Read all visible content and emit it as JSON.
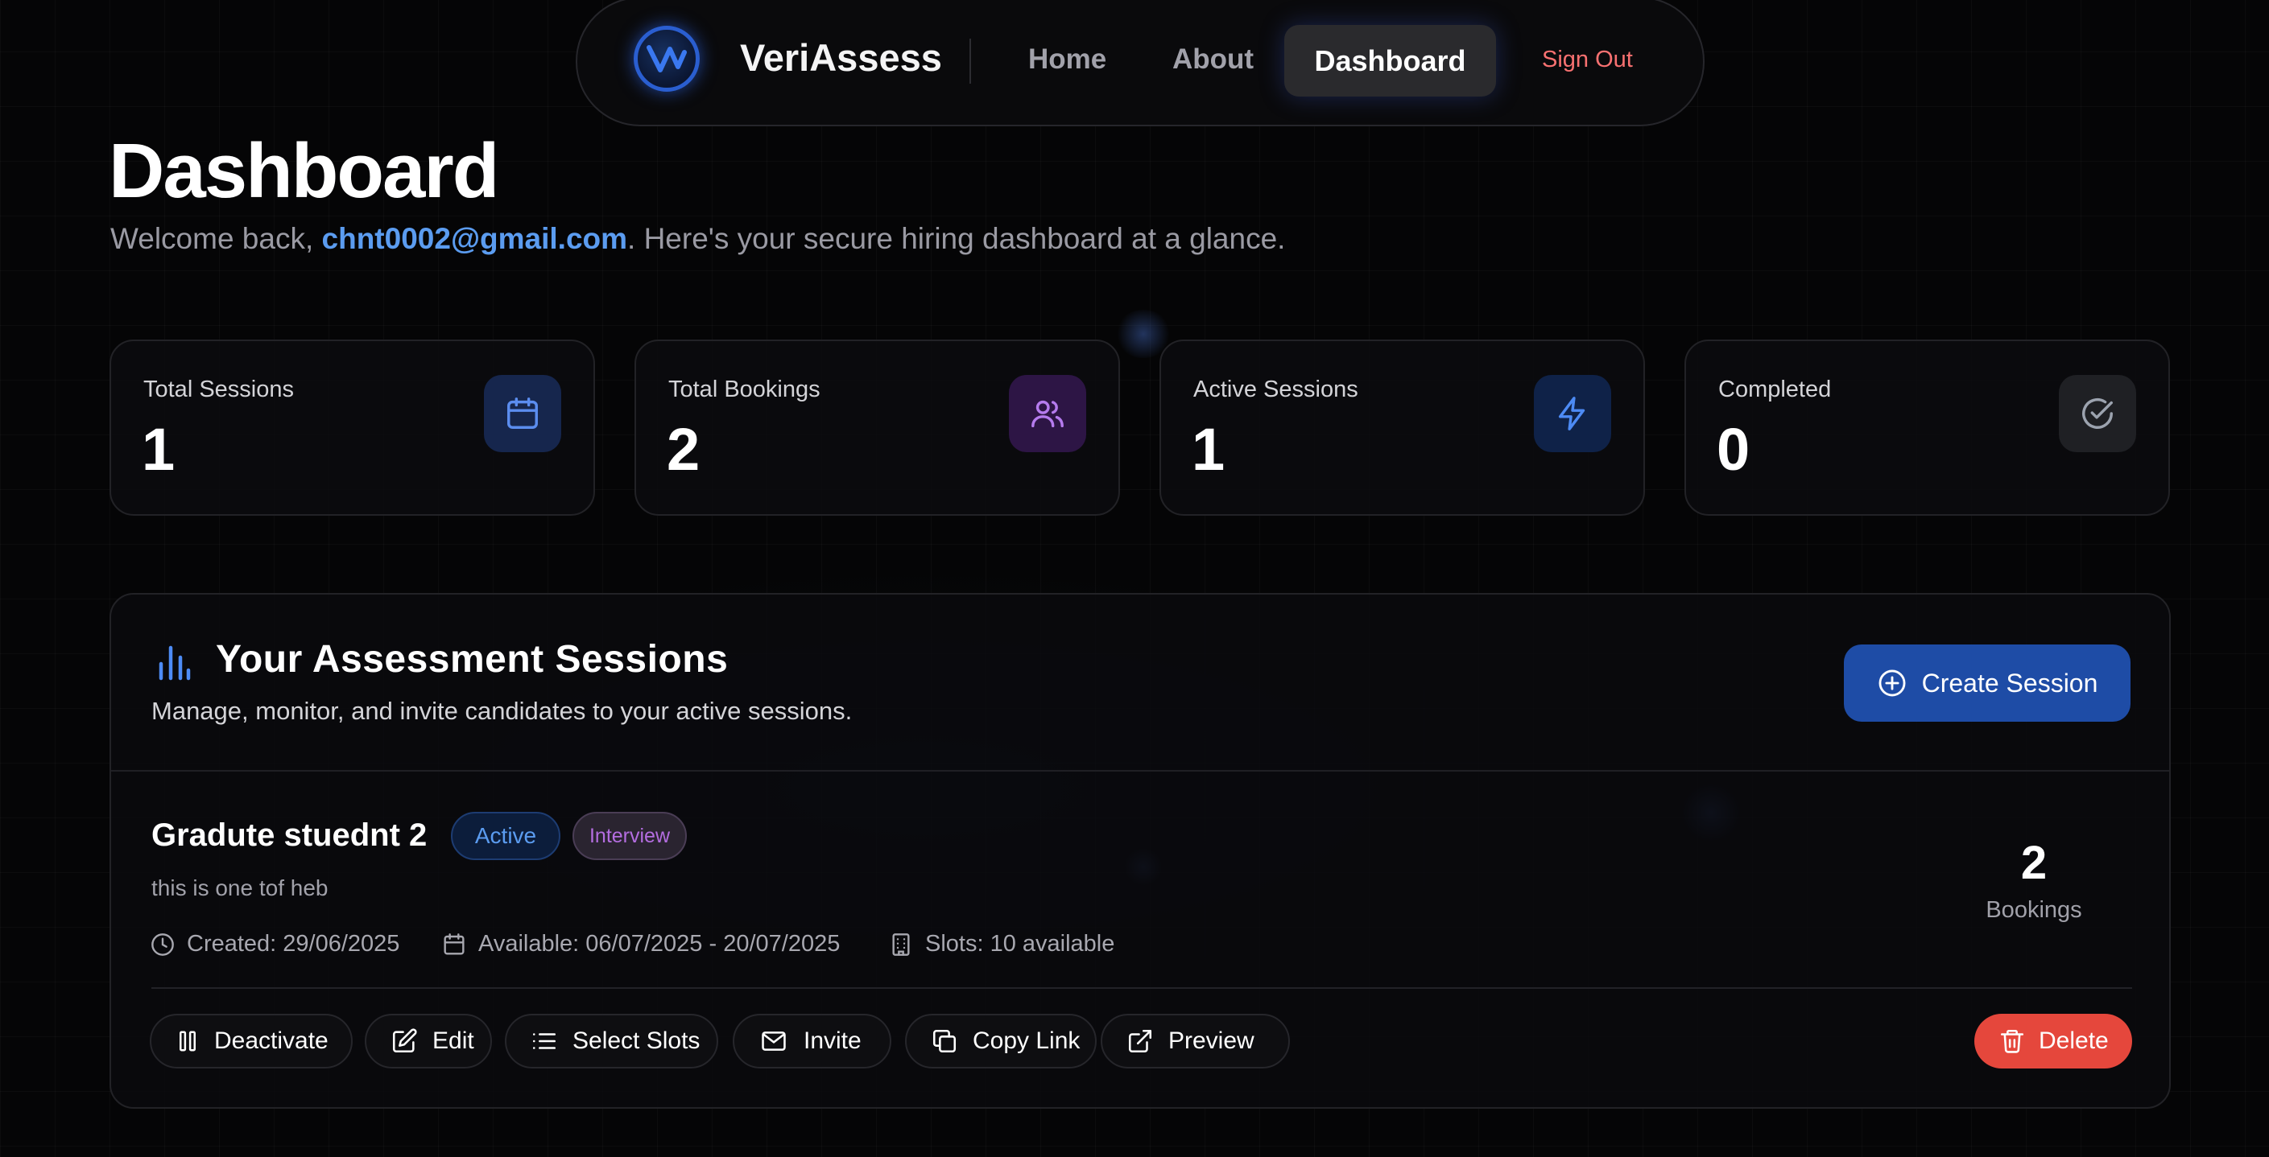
{
  "nav": {
    "brand": "VeriAssess",
    "links": [
      {
        "label": "Home"
      },
      {
        "label": "About"
      },
      {
        "label": "Dashboard"
      }
    ],
    "sign_out": "Sign Out",
    "logo_icon": "veriassess-logo-icon",
    "active": "Dashboard"
  },
  "header": {
    "title": "Dashboard",
    "welcome_prefix": "Welcome back, ",
    "email": "chnt0002@gmail.com",
    "welcome_suffix": ". Here's your secure hiring dashboard at a glance."
  },
  "stats": [
    {
      "label": "Total Sessions",
      "value": "1",
      "icon": "calendar-icon",
      "color": "#5b8def"
    },
    {
      "label": "Total Bookings",
      "value": "2",
      "icon": "users-icon",
      "color": "#b57bee"
    },
    {
      "label": "Active Sessions",
      "value": "1",
      "icon": "lightning-icon",
      "color": "#4d8bf5"
    },
    {
      "label": "Completed",
      "value": "0",
      "icon": "check-circle-icon",
      "color": "#9ca3af"
    }
  ],
  "sessions": {
    "title": "Your Assessment Sessions",
    "subtitle": "Manage, monitor, and invite candidates to your active sessions.",
    "create_label": "Create Session",
    "items": [
      {
        "name": "Gradute stuednt 2",
        "status": "Active",
        "type": "Interview",
        "description": "this is one tof heb",
        "created": "Created: 29/06/2025",
        "available": "Available: 06/07/2025 - 20/07/2025",
        "slots": "Slots: 10 available",
        "bookings_count": "2",
        "bookings_label": "Bookings",
        "actions": {
          "deactivate": "Deactivate",
          "edit": "Edit",
          "select_slots": "Select Slots",
          "invite": "Invite",
          "copy_link": "Copy Link",
          "preview": "Preview",
          "delete": "Delete"
        }
      }
    ]
  },
  "colors": {
    "accent_blue": "#1e4ca6",
    "link_blue": "#5b9cf0",
    "danger": "#e5473c",
    "sign_out": "#f87171"
  }
}
